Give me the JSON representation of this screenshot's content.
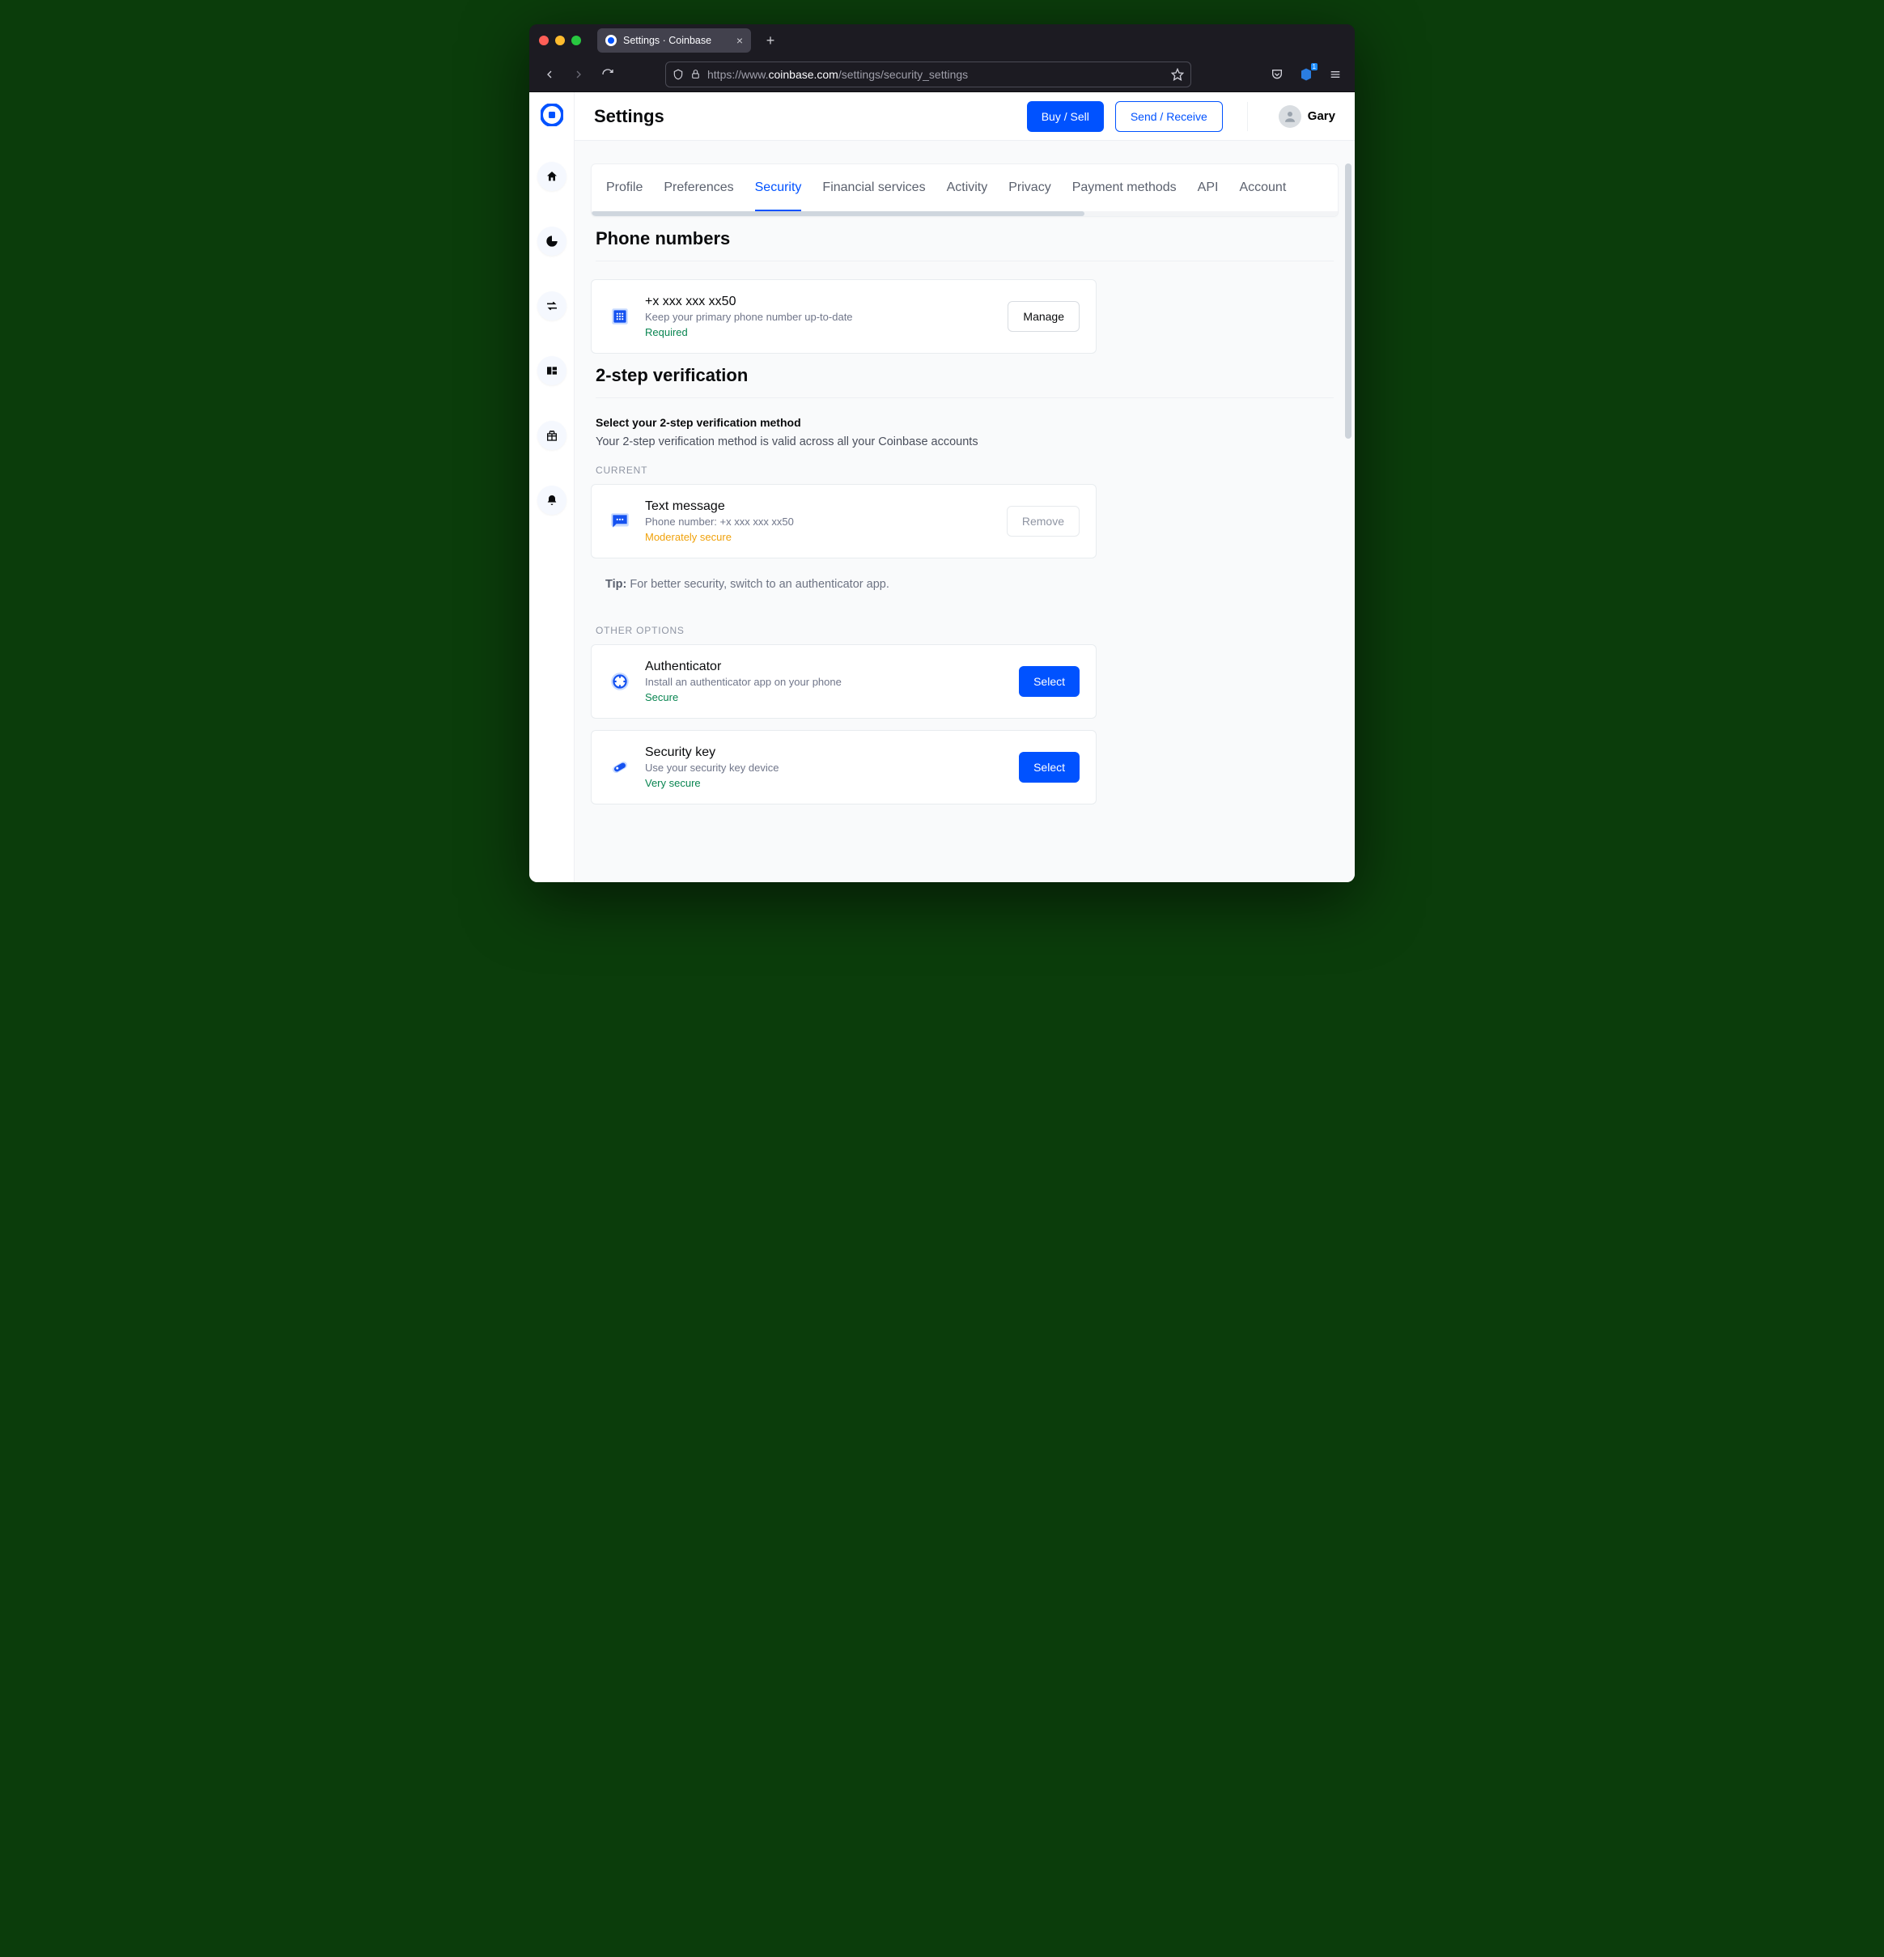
{
  "browser": {
    "tab_title": "Settings · Coinbase",
    "url_prefix": "https://www.",
    "url_domain": "coinbase.com",
    "url_path": "/settings/security_settings",
    "ext_badge": "1"
  },
  "header": {
    "title": "Settings",
    "buy_sell": "Buy / Sell",
    "send_receive": "Send / Receive",
    "username": "Gary"
  },
  "tabs": [
    "Profile",
    "Preferences",
    "Security",
    "Financial services",
    "Activity",
    "Privacy",
    "Payment methods",
    "API",
    "Account"
  ],
  "active_tab_index": 2,
  "phone_section": {
    "heading": "Phone numbers",
    "number": "+x xxx xxx xx50",
    "sub": "Keep your primary phone number up-to-date",
    "badge": "Required",
    "manage": "Manage"
  },
  "twostep": {
    "heading": "2-step verification",
    "subhead": "Select your 2-step verification method",
    "subp": "Your 2-step verification method is valid across all your Coinbase accounts",
    "current_label": "CURRENT",
    "current": {
      "title": "Text message",
      "sub": "Phone number: +x xxx xxx xx50",
      "badge": "Moderately secure",
      "action": "Remove"
    },
    "tip_label": "Tip:",
    "tip_text": "For better security, switch to an authenticator app.",
    "other_label": "OTHER OPTIONS",
    "options": [
      {
        "title": "Authenticator",
        "sub": "Install an authenticator app on your phone",
        "badge": "Secure",
        "action": "Select"
      },
      {
        "title": "Security key",
        "sub": "Use your security key device",
        "badge": "Very secure",
        "action": "Select"
      }
    ]
  }
}
